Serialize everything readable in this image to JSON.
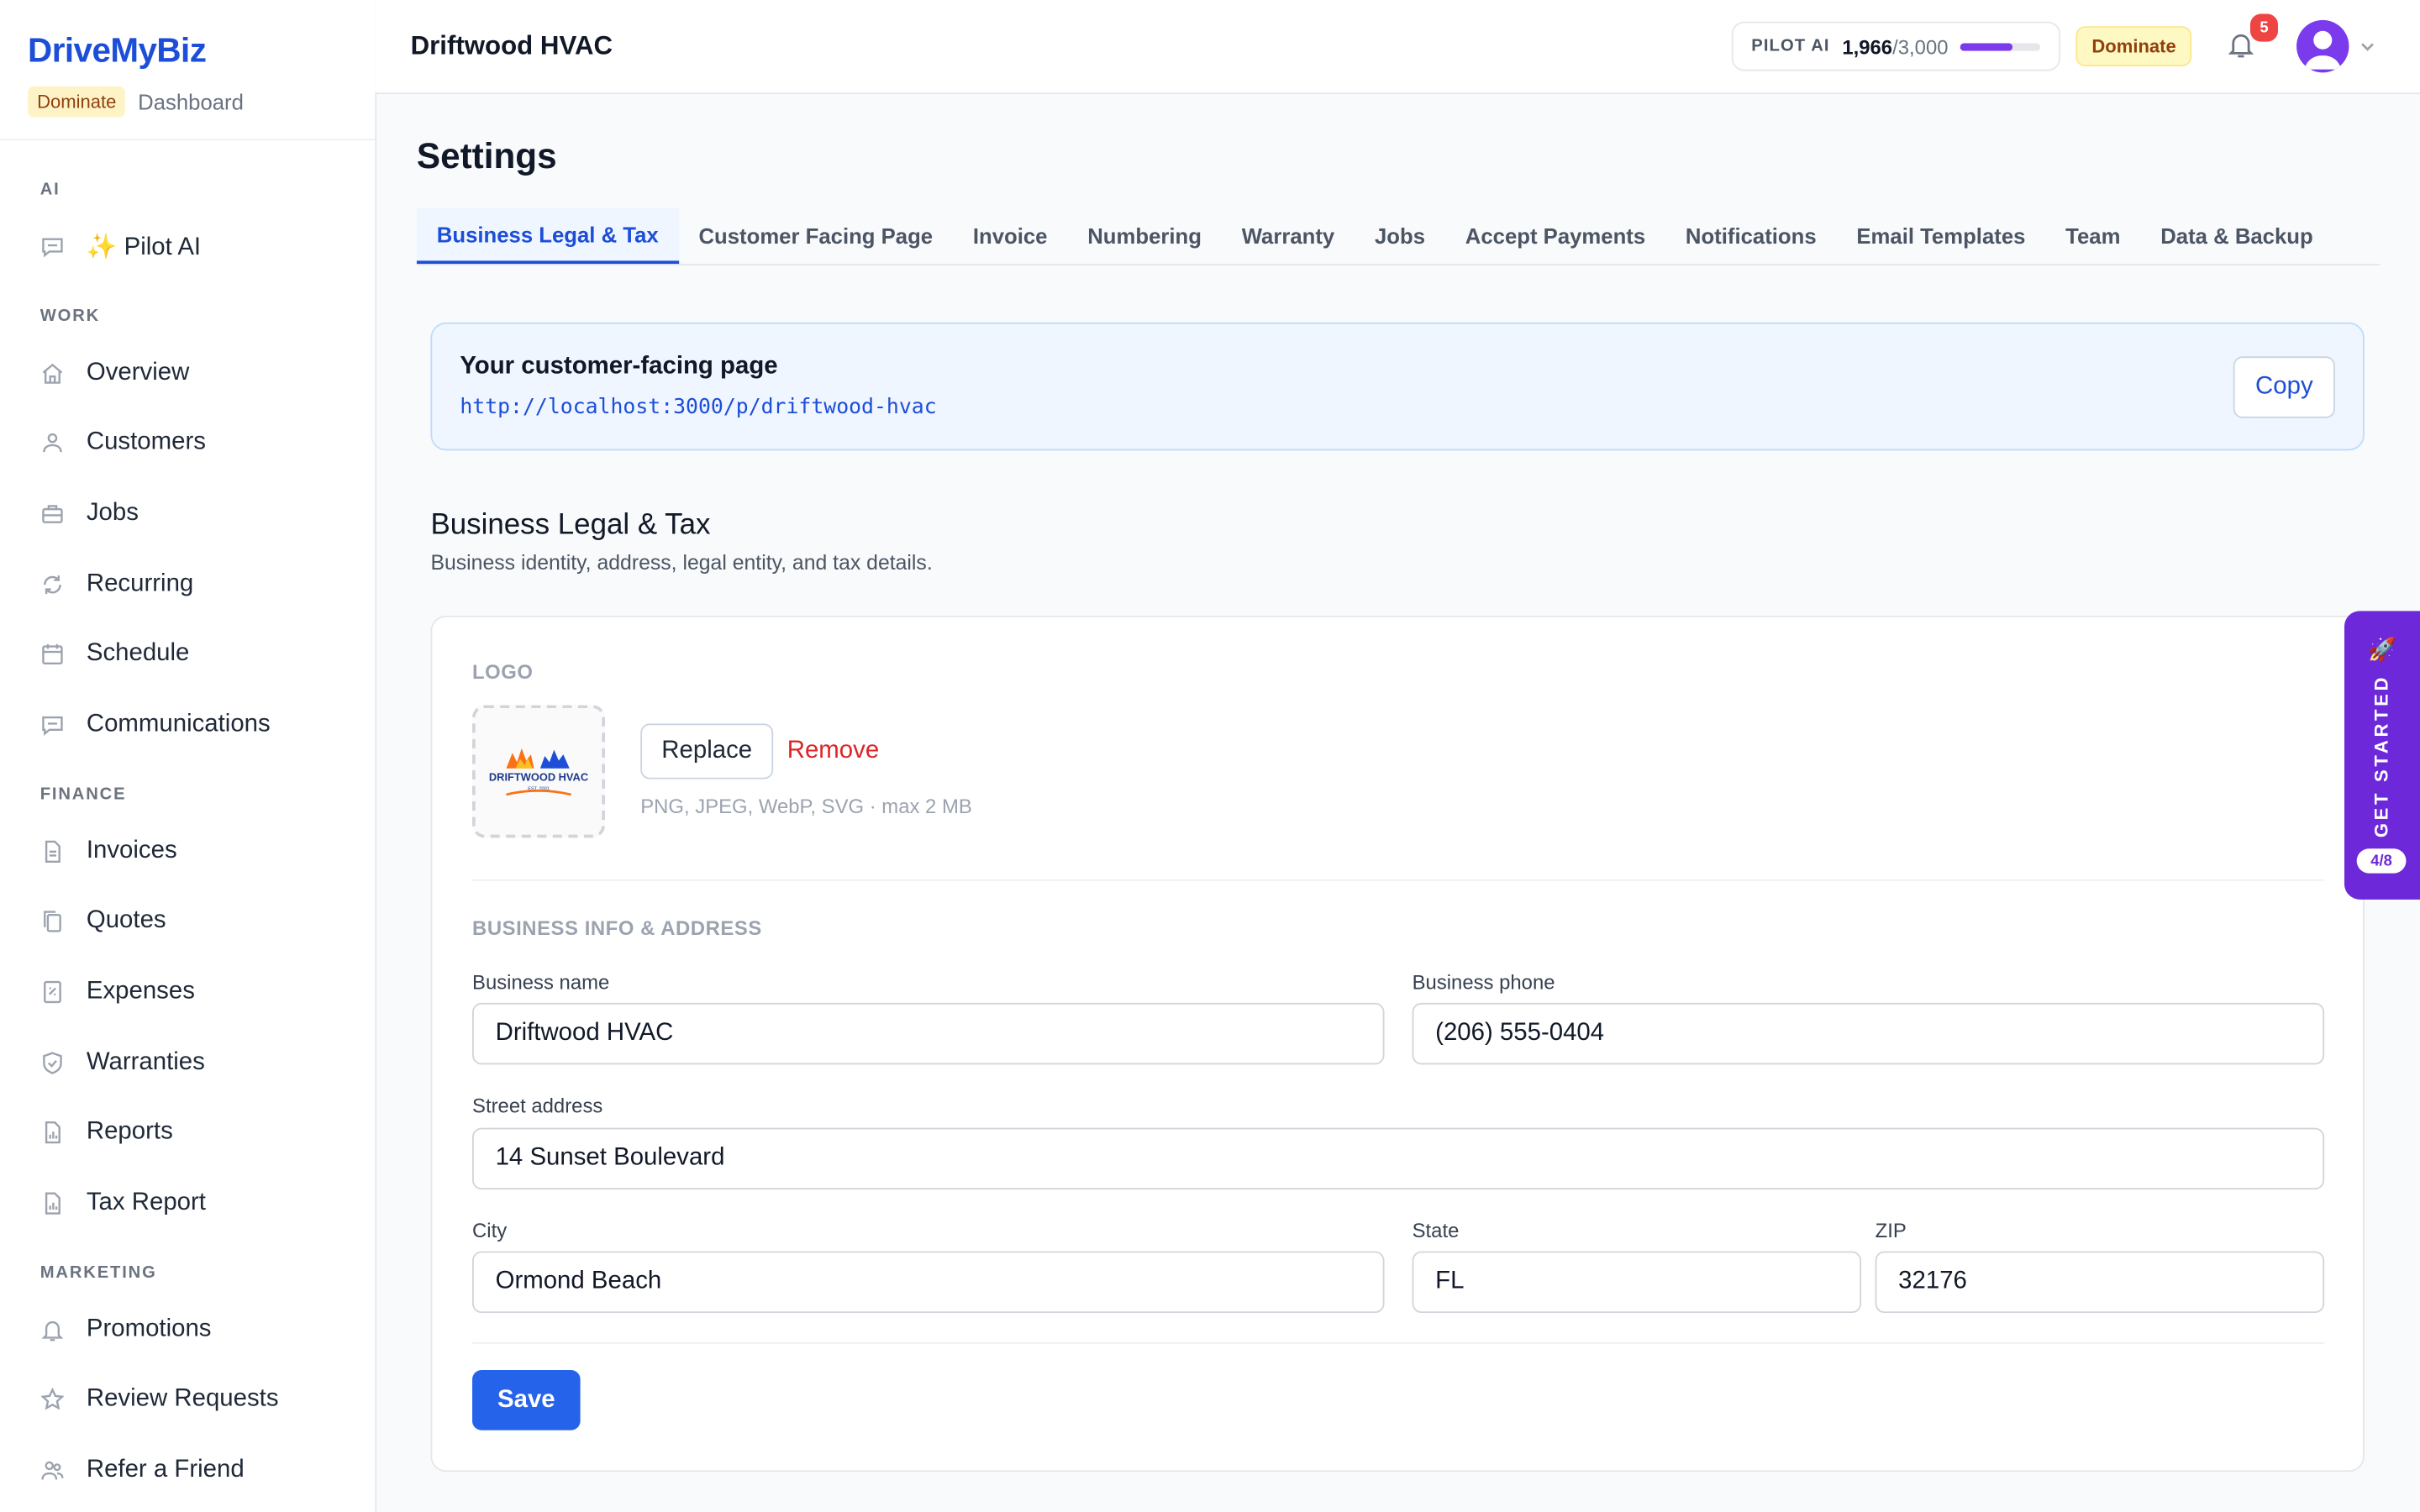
{
  "brand": {
    "name": "DriveMyBiz",
    "plan_badge": "Dominate",
    "context": "Dashboard"
  },
  "sidebar": {
    "sections": [
      {
        "title": "AI",
        "items": [
          {
            "label": "✨ Pilot AI",
            "icon": "chat-icon"
          }
        ]
      },
      {
        "title": "WORK",
        "items": [
          {
            "label": "Overview",
            "icon": "home-icon"
          },
          {
            "label": "Customers",
            "icon": "users-icon"
          },
          {
            "label": "Jobs",
            "icon": "briefcase-icon"
          },
          {
            "label": "Recurring",
            "icon": "refresh-icon"
          },
          {
            "label": "Schedule",
            "icon": "calendar-icon"
          },
          {
            "label": "Communications",
            "icon": "chat-icon"
          }
        ]
      },
      {
        "title": "FINANCE",
        "items": [
          {
            "label": "Invoices",
            "icon": "document-icon"
          },
          {
            "label": "Quotes",
            "icon": "copy-icon"
          },
          {
            "label": "Expenses",
            "icon": "receipt-icon"
          },
          {
            "label": "Warranties",
            "icon": "shield-icon"
          },
          {
            "label": "Reports",
            "icon": "report-icon"
          },
          {
            "label": "Tax Report",
            "icon": "report-icon"
          }
        ]
      },
      {
        "title": "MARKETING",
        "items": [
          {
            "label": "Promotions",
            "icon": "bell-icon"
          },
          {
            "label": "Review Requests",
            "icon": "star-icon"
          },
          {
            "label": "Refer a Friend",
            "icon": "users-icon"
          }
        ]
      }
    ]
  },
  "header": {
    "title": "Driftwood HVAC",
    "pilot_label": "PILOT AI",
    "pilot_used": "1,966",
    "pilot_total": "/3,000",
    "pilot_fraction": 0.655,
    "plan_badge": "Dominate",
    "notification_count": "5"
  },
  "main": {
    "title": "Settings",
    "tabs": [
      {
        "label": "Business Legal & Tax",
        "active": true
      },
      {
        "label": "Customer Facing Page"
      },
      {
        "label": "Invoice"
      },
      {
        "label": "Numbering"
      },
      {
        "label": "Warranty"
      },
      {
        "label": "Jobs"
      },
      {
        "label": "Accept Payments"
      },
      {
        "label": "Notifications"
      },
      {
        "label": "Email Templates"
      },
      {
        "label": "Team"
      },
      {
        "label": "Data & Backup"
      }
    ],
    "customer_page": {
      "title": "Your customer-facing page",
      "url": "http://localhost:3000/p/driftwood-hvac",
      "copy_label": "Copy"
    },
    "section": {
      "title": "Business Legal & Tax",
      "subtitle": "Business identity, address, legal entity, and tax details."
    },
    "logo": {
      "caption": "LOGO",
      "logo_text": "DRIFTWOOD HVAC",
      "logo_est": "EST. 2001",
      "replace_label": "Replace",
      "remove_label": "Remove",
      "hint": "PNG, JPEG, WebP, SVG · max 2 MB"
    },
    "info": {
      "caption": "BUSINESS INFO & ADDRESS",
      "business_name_label": "Business name",
      "business_name": "Driftwood HVAC",
      "phone_label": "Business phone",
      "phone": "(206) 555-0404",
      "street_label": "Street address",
      "street": "14 Sunset Boulevard",
      "city_label": "City",
      "city": "Ormond Beach",
      "state_label": "State",
      "state": "FL",
      "zip_label": "ZIP",
      "zip": "32176"
    },
    "save_label": "Save"
  },
  "get_started": {
    "label": "GET STARTED",
    "progress": "4/8"
  },
  "colors": {
    "brand": "#1d4ed8",
    "accent": "#2563eb",
    "pilot": "#7c3aed",
    "danger": "#dc2626",
    "badge": "#ef4444"
  }
}
